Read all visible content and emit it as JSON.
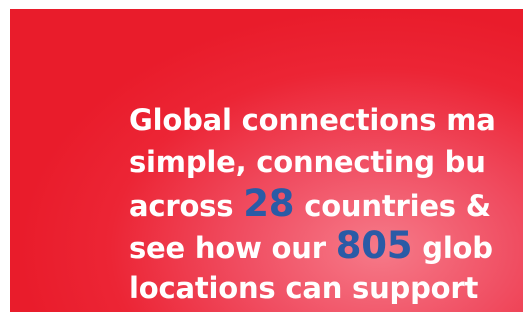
{
  "promo": {
    "line1": "Global connections ma",
    "line2": "simple, connecting bu",
    "line3_before": "across ",
    "line3_number": "28",
    "line3_after": " countries &",
    "line4_before": "see how our ",
    "line4_number": "805",
    "line4_after": " glob",
    "line5": "locations can support"
  },
  "colors": {
    "background_red": "#ec2535",
    "highlight_pink": "#f67a89",
    "headline_text": "#ffffff",
    "stat_blue": "#2a5ba6"
  }
}
